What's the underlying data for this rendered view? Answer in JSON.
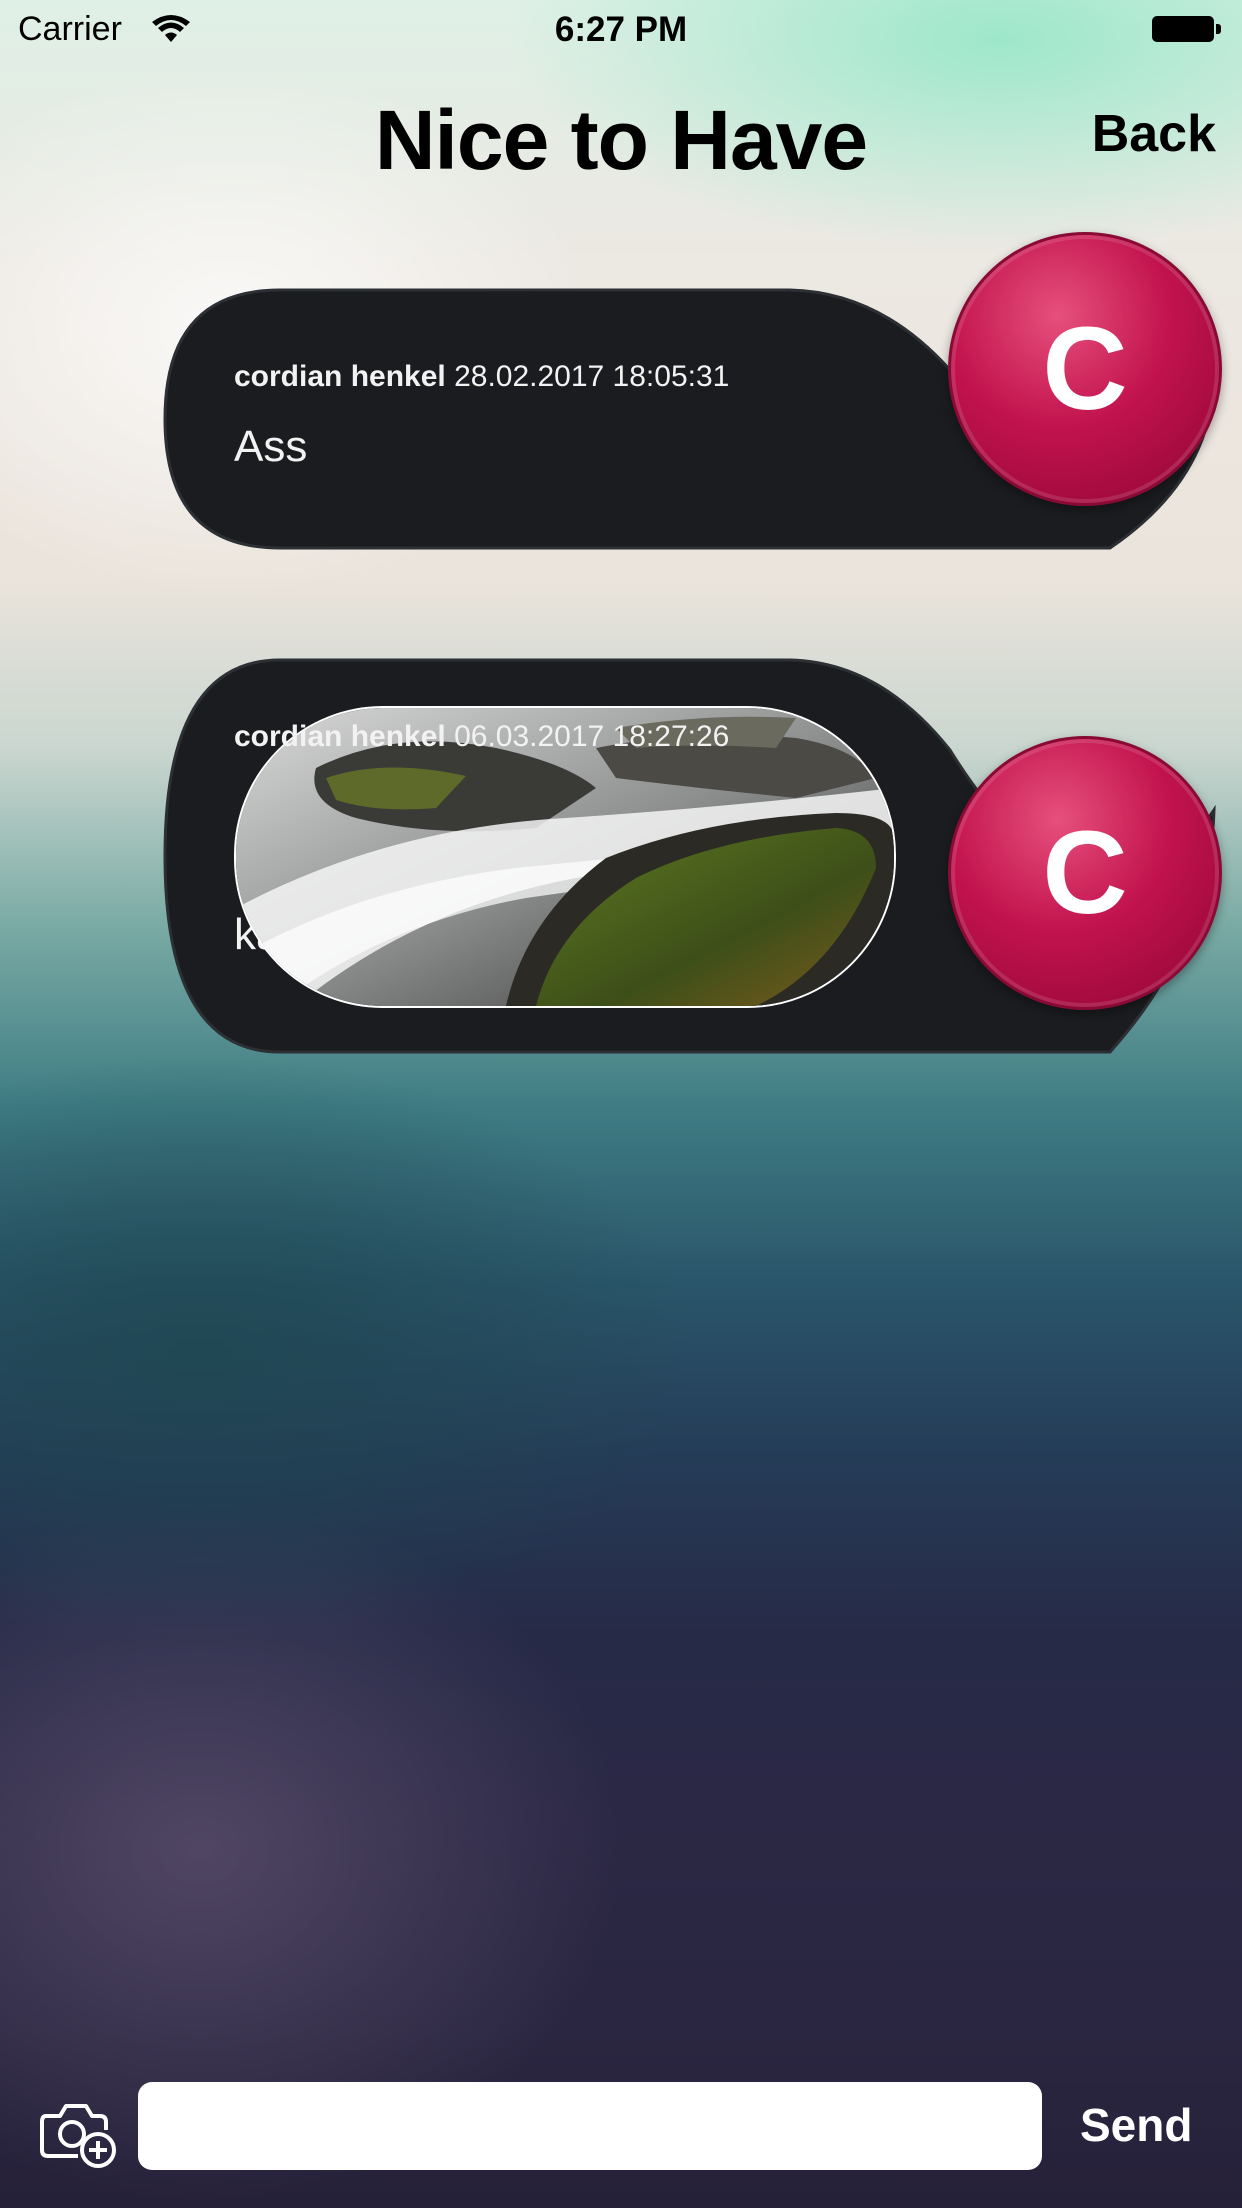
{
  "status_bar": {
    "carrier": "Carrier",
    "time": "6:27 PM"
  },
  "nav": {
    "title": "Nice to Have",
    "back_label": "Back"
  },
  "messages": [
    {
      "author": "cordian henkel",
      "timestamp": "28.02.2017 18:05:31",
      "text": "Ass",
      "avatar_initial": "C"
    },
    {
      "author": "cordian henkel",
      "timestamp": "06.03.2017 18:27:26",
      "text": "ka",
      "avatar_initial": "C",
      "has_photo": true
    }
  ],
  "composer": {
    "input_value": "",
    "send_label": "Send"
  },
  "colors": {
    "bubble": "#1a1c1f",
    "avatar": "#c2134e",
    "send_text": "#ffffff"
  },
  "icons": {
    "wifi": "wifi-icon",
    "battery": "battery-icon",
    "add_photo": "camera-add-icon"
  }
}
